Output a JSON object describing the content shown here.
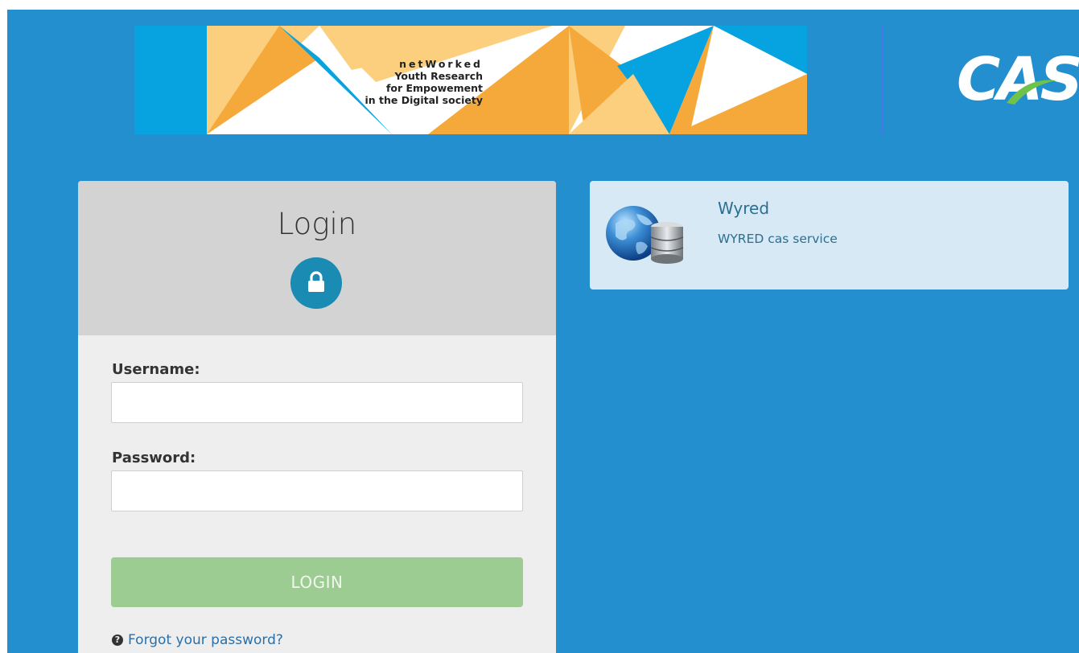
{
  "banner": {
    "line1": "netWorked",
    "line2": "Youth Research",
    "line3": "for Empowement",
    "line4": "in the Digital society",
    "colors": {
      "orange": "#f5a93a",
      "light_orange": "#fbcf7e",
      "blue": "#07a3e0",
      "white": "#ffffff"
    }
  },
  "brand": {
    "logo_text": "CAS",
    "background_color": "#238fcf"
  },
  "login": {
    "title": "Login",
    "lock_icon": "lock-icon",
    "username_label": "Username:",
    "username_value": "",
    "password_label": "Password:",
    "password_value": "",
    "submit_label": "LOGIN",
    "forgot_label": "Forgot your password?",
    "button_color": "#9ccc91"
  },
  "service": {
    "name": "Wyred",
    "description": "WYRED cas service",
    "icon": "globe-database-icon"
  }
}
